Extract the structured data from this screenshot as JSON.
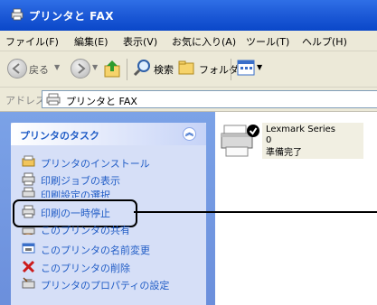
{
  "window": {
    "title": "プリンタと FAX"
  },
  "menu": [
    "ファイル(F)",
    "編集(E)",
    "表示(V)",
    "お気に入り(A)",
    "ツール(T)",
    "ヘルプ(H)"
  ],
  "toolbar": {
    "back_label": "戻る",
    "search_label": "検索",
    "folders_label": "フォルダ"
  },
  "address": {
    "label": "アドレス(D)",
    "value": "プリンタと FAX"
  },
  "task_panel": {
    "title": "プリンタのタスク",
    "items": [
      {
        "label": "プリンタのインストール",
        "icon": "add-printer-icon"
      },
      {
        "label": "印刷ジョブの表示",
        "icon": "print-jobs-icon"
      },
      {
        "label": "印刷設定の選択",
        "icon": "printing-preferences-icon"
      },
      {
        "label": "印刷の一時停止",
        "icon": "pause-printing-icon"
      },
      {
        "label": "このプリンタの共有",
        "icon": "share-icon"
      },
      {
        "label": "このプリンタの名前変更",
        "icon": "rename-icon"
      },
      {
        "label": "このプリンタの削除",
        "icon": "delete-icon"
      },
      {
        "label": "プリンタのプロパティの設定",
        "icon": "properties-icon"
      }
    ]
  },
  "printer": {
    "name": "Lexmark Series",
    "jobs": "0",
    "status": "準備完了"
  },
  "colors": {
    "titlebar": "#0a47c9",
    "task_link": "#215dc6",
    "panel_bg": "#6b8fdc",
    "delete_icon": "#cc1a1a"
  }
}
